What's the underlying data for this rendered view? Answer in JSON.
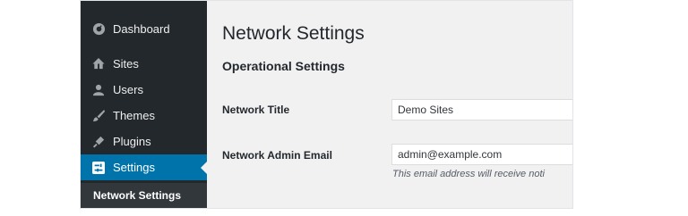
{
  "sidebar": {
    "items": [
      {
        "label": "Dashboard",
        "icon": "dashboard-icon"
      },
      {
        "label": "Sites",
        "icon": "sites-icon"
      },
      {
        "label": "Users",
        "icon": "users-icon"
      },
      {
        "label": "Themes",
        "icon": "themes-icon"
      },
      {
        "label": "Plugins",
        "icon": "plugins-icon"
      },
      {
        "label": "Settings",
        "icon": "settings-icon"
      }
    ],
    "submenu_label": "Network Settings"
  },
  "main": {
    "page_title": "Network Settings",
    "section_title": "Operational Settings",
    "fields": {
      "network_title": {
        "label": "Network Title",
        "value": "Demo Sites"
      },
      "admin_email": {
        "label": "Network Admin Email",
        "value": "admin@example.com",
        "description": "This email address will receive noti"
      }
    }
  },
  "colors": {
    "sidebar_bg": "#23282d",
    "active_bg": "#0073aa",
    "content_bg": "#f1f1f1"
  }
}
